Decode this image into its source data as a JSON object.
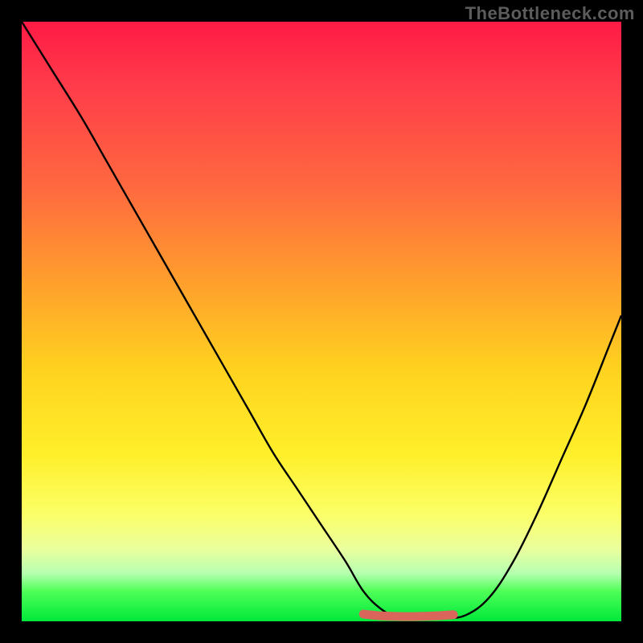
{
  "watermark": "TheBottleneck.com",
  "chart_data": {
    "type": "line",
    "title": "",
    "xlabel": "",
    "ylabel": "",
    "xlim": [
      0,
      100
    ],
    "ylim": [
      0,
      100
    ],
    "series": [
      {
        "name": "bottleneck-curve",
        "x": [
          0,
          5,
          10,
          14,
          18,
          22,
          26,
          30,
          34,
          38,
          42,
          46,
          50,
          54,
          57,
          60,
          63,
          66,
          70,
          74,
          78,
          82,
          86,
          90,
          94,
          98,
          100
        ],
        "y": [
          100,
          92,
          84,
          77,
          70,
          63,
          56,
          49,
          42,
          35,
          28,
          22,
          16,
          10,
          5,
          2,
          0.5,
          0.5,
          0.5,
          1,
          4,
          10,
          18,
          27,
          36,
          46,
          51
        ]
      },
      {
        "name": "highlight-band",
        "x": [
          57,
          60,
          63,
          66,
          69,
          72
        ],
        "y": [
          1.2,
          0.9,
          0.8,
          0.8,
          0.9,
          1.1
        ]
      }
    ],
    "colors": {
      "curve": "#000000",
      "highlight": "#d9655b",
      "gradient_top": "#ff1a45",
      "gradient_mid": "#ffd21f",
      "gradient_bottom": "#00e83a",
      "frame": "#000000",
      "watermark": "#5c5c5c"
    }
  }
}
